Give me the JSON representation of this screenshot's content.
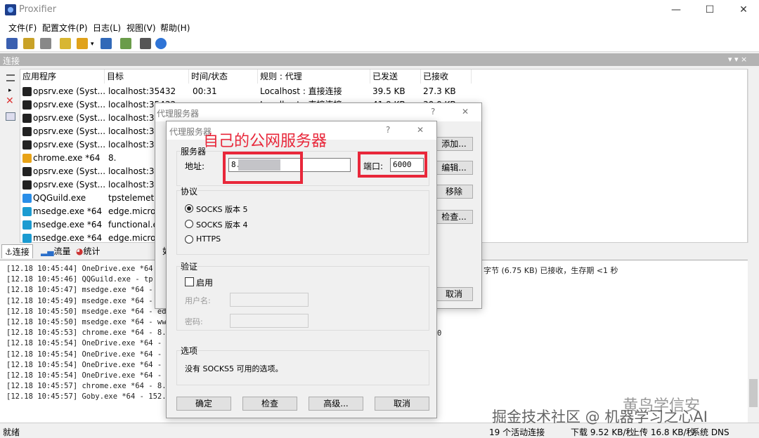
{
  "window": {
    "title": "Proxifier",
    "min": "—",
    "max": "☐",
    "close": "✕"
  },
  "menu": [
    "文件(F)",
    "配置文件(P)",
    "日志(L)",
    "视图(V)",
    "帮助(H)"
  ],
  "panel": {
    "title": "连接",
    "pin": "▾ ▾ ×"
  },
  "table": {
    "headers": [
      "应用程序",
      "目标",
      "时间/状态",
      "规则 : 代理",
      "已发送",
      "已接收"
    ],
    "rows": [
      {
        "app": "opsrv.exe (Syst...",
        "target": "localhost:35432",
        "time": "00:31",
        "rule": "Localhost : 直接连接",
        "sent": "39.5 KB",
        "recv": "27.3 KB",
        "icon": "#222"
      },
      {
        "app": "opsrv.exe (Syst...",
        "target": "localhost:35432",
        "time": "",
        "rule": "Localhost : 直接连接",
        "sent": "41.9 KB",
        "recv": "30.0 KB",
        "icon": "#222"
      },
      {
        "app": "opsrv.exe (Syst...",
        "target": "localhost:35",
        "time": "",
        "rule": "",
        "sent": "",
        "recv": "",
        "icon": "#222"
      },
      {
        "app": "opsrv.exe (Syst...",
        "target": "localhost:35",
        "time": "",
        "rule": "",
        "sent": "",
        "recv": "",
        "icon": "#222"
      },
      {
        "app": "opsrv.exe (Syst...",
        "target": "localhost:35",
        "time": "",
        "rule": "",
        "sent": "",
        "recv": "",
        "icon": "#222"
      },
      {
        "app": "chrome.exe *64",
        "target": "8.",
        "time": "",
        "rule": "",
        "sent": "",
        "recv": "",
        "icon": "#e8a317"
      },
      {
        "app": "opsrv.exe (Syst...",
        "target": "localhost:35",
        "time": "",
        "rule": "",
        "sent": "",
        "recv": "",
        "icon": "#222"
      },
      {
        "app": "opsrv.exe (Syst...",
        "target": "localhost:35",
        "time": "",
        "rule": "",
        "sent": "",
        "recv": "",
        "icon": "#222"
      },
      {
        "app": "QQGuild.exe",
        "target": "tpstelemet",
        "time": "",
        "rule": "",
        "sent": "",
        "recv": "",
        "icon": "#2a8ee8"
      },
      {
        "app": "msedge.exe *64",
        "target": "edge.micro",
        "time": "",
        "rule": "",
        "sent": "",
        "recv": "",
        "icon": "#1b9bd1"
      },
      {
        "app": "msedge.exe *64",
        "target": "functional.e",
        "time": "",
        "rule": "",
        "sent": "",
        "recv": "",
        "icon": "#1b9bd1"
      },
      {
        "app": "msedge.exe *64",
        "target": "edge.micro",
        "time": "",
        "rule": "",
        "sent": "",
        "recv": "",
        "icon": "#1b9bd1"
      }
    ]
  },
  "tabs": [
    "连接",
    "流量",
    "统计"
  ],
  "logs": [
    "[12.18 10:45:44] OneDrive.exe *64",
    "[12.18 10:45:46] QQGuild.exe - tp",
    "[12.18 10:45:47] msedge.exe *64 -",
    "[12.18 10:45:49] msedge.exe *64 -",
    "[12.18 10:45:50] msedge.exe *64 - ed",
    "[12.18 10:45:50] msedge.exe *64 - ww",
    "[12.18 10:45:53] chrome.exe *64 - 8.",
    "[12.18 10:45:54] OneDrive.exe *64 -",
    "[12.18 10:45:54] OneDrive.exe *64 -",
    "[12.18 10:45:54] OneDrive.exe *64 -",
    "[12.18 10:45:54] OneDrive.exe *64 -",
    "[12.18 10:45:57] chrome.exe *64 - 8.",
    "[12.18 10:45:57] Goby.exe *64 - 152."
  ],
  "log_tail": {
    "line1": "字节 (6.75 KB) 已接收，生存期 <1 秒",
    "line7": "0"
  },
  "status": {
    "ready": "就绪",
    "active": "19 个活动连接",
    "down": "下载 9.52 KB/秒",
    "up": "上传 16.8 KB/秒",
    "dns": "系统 DNS"
  },
  "watermark": {
    "a": "掘金技术社区 @ 机器学习之心AI",
    "b": "黄鸟学信安"
  },
  "back_dialog": {
    "title": "代理服务器",
    "help": "?",
    "close": "✕",
    "buttons": [
      "添加...",
      "编辑...",
      "移除",
      "检查..."
    ],
    "cancel": "取消",
    "side_label": "如"
  },
  "dialog": {
    "title": "代理服务器",
    "help": "?",
    "close": "✕",
    "annotation": "自己的公网服务器",
    "server_group": "服务器",
    "address_label": "地址:",
    "address_value": "8.1",
    "port_label": "端口:",
    "port_value": "6000",
    "protocol_group": "协议",
    "protocols": [
      "SOCKS 版本 5",
      "SOCKS 版本 4",
      "HTTPS"
    ],
    "auth_group": "验证",
    "enable_label": "启用",
    "user_label": "用户名:",
    "pass_label": "密码:",
    "options_group": "选项",
    "options_text": "没有 SOCKS5 可用的选项。",
    "buttons": [
      "确定",
      "检查",
      "高级...",
      "取消"
    ]
  },
  "colors": {
    "accent": "#e8273a",
    "panel": "#b3b3b3"
  }
}
